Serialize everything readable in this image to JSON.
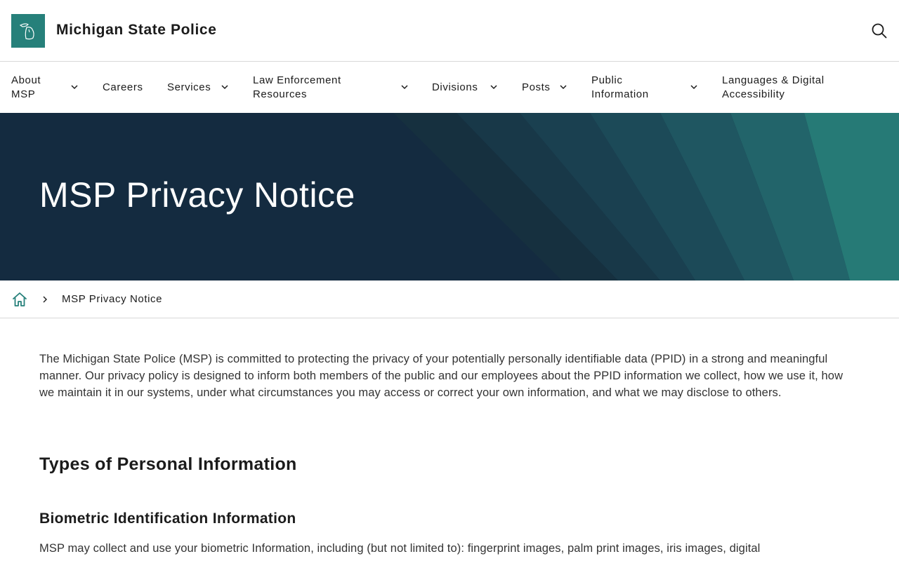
{
  "header": {
    "title": "Michigan State Police",
    "logo_icon": "michigan-map-icon",
    "search_icon": "search-icon"
  },
  "nav": {
    "items": [
      {
        "label": "About MSP",
        "has_dropdown": true
      },
      {
        "label": "Careers",
        "has_dropdown": false
      },
      {
        "label": "Services",
        "has_dropdown": true
      },
      {
        "label": "Law Enforcement Resources",
        "has_dropdown": true
      },
      {
        "label": "Divisions",
        "has_dropdown": true
      },
      {
        "label": "Posts",
        "has_dropdown": true
      },
      {
        "label": "Public Information",
        "has_dropdown": true
      },
      {
        "label": "Languages & Digital Accessibility",
        "has_dropdown": false
      }
    ]
  },
  "hero": {
    "title": "MSP Privacy Notice"
  },
  "breadcrumb": {
    "home_icon": "home-icon",
    "current": "MSP Privacy Notice"
  },
  "content": {
    "intro": "The Michigan State Police (MSP) is committed to protecting the privacy of your potentially personally identifiable data (PPID) in a strong and meaningful manner. Our privacy policy is designed to inform both members of the public and our employees about the PPID information we collect, how we use it, how we maintain it in our systems, under what circumstances you may access or correct your own information, and what we may disclose to others.",
    "heading": "Types of Personal Information",
    "subheading": "Biometric Identification Information",
    "paragraph": "MSP may collect and use your biometric Information, including (but not limited to): fingerprint images, palm print images, iris images, digital"
  },
  "colors": {
    "brand_teal": "#26807a",
    "hero_navy": "#142b40"
  }
}
